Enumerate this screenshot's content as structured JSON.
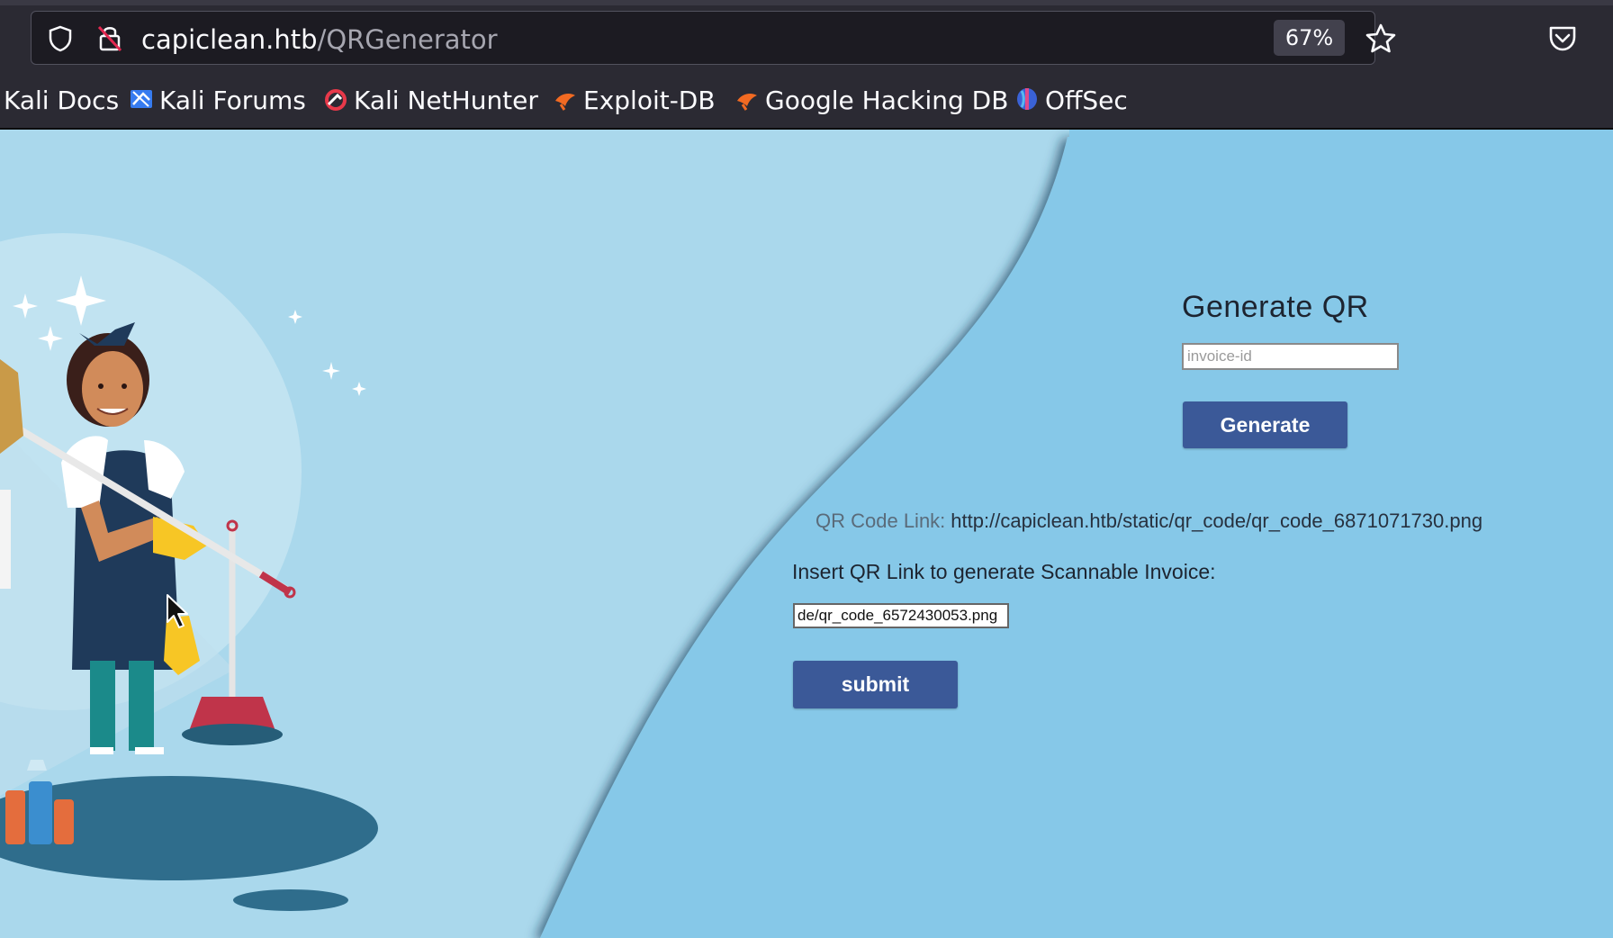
{
  "browser": {
    "url_host": "capiclean.htb",
    "url_path": "/QRGenerator",
    "zoom": "67%",
    "bookmarks": [
      {
        "label": "Kali Docs",
        "icon": "kali-docs-icon"
      },
      {
        "label": "Kali Forums",
        "icon": "kali-forums-icon"
      },
      {
        "label": "Kali NetHunter",
        "icon": "kali-nethunter-icon"
      },
      {
        "label": "Exploit-DB",
        "icon": "exploit-db-icon"
      },
      {
        "label": "Google Hacking DB",
        "icon": "google-hacking-db-icon"
      },
      {
        "label": "OffSec",
        "icon": "offsec-icon"
      }
    ]
  },
  "form": {
    "title": "Generate QR",
    "invoice_placeholder": "invoice-id",
    "generate_label": "Generate",
    "qr_link_label": "QR Code Link:",
    "qr_link_value": "http://capiclean.htb/static/qr_code/qr_code_6871071730.png",
    "insert_label": "Insert QR Link to generate Scannable Invoice:",
    "qr_input_value": "de/qr_code_6572430053.png",
    "submit_label": "submit"
  },
  "colors": {
    "page_light": "#aad8ec",
    "page_dark": "#86c8e8",
    "button": "#3b5998"
  }
}
